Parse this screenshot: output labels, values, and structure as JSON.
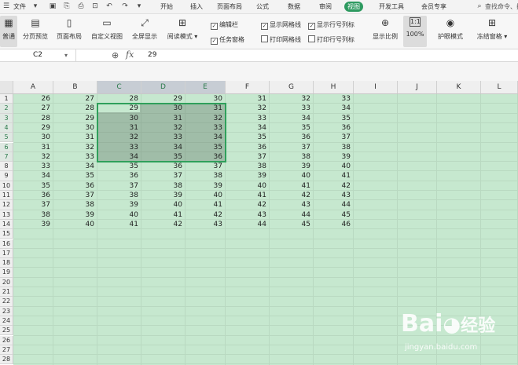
{
  "menubar": {
    "file_label": "文件",
    "tabs": [
      "开始",
      "插入",
      "页面布局",
      "公式",
      "数据",
      "审阅",
      "视图",
      "开发工具",
      "会员专享"
    ],
    "active_tab": "视图",
    "search_placeholder": "查找命令、搜"
  },
  "ribbon": {
    "buttons": [
      "普通",
      "分页预览",
      "页面布局",
      "自定义视图",
      "全屏显示",
      "阅读模式"
    ],
    "checks": [
      {
        "label": "编辑栏",
        "checked": true
      },
      {
        "label": "显示网格线",
        "checked": true
      },
      {
        "label": "显示行号列标",
        "checked": true
      },
      {
        "label": "任务窗格",
        "checked": true
      },
      {
        "label": "打印网格线",
        "checked": false
      },
      {
        "label": "打印行号列标",
        "checked": false
      }
    ],
    "zoom_label": "显示比例",
    "zoom_value": "100%",
    "eye_label": "护眼模式",
    "freeze_label": "冻结窗格"
  },
  "formula": {
    "cell_ref": "C2",
    "fx": "fx",
    "value": "29"
  },
  "columns": [
    "A",
    "B",
    "C",
    "D",
    "E",
    "F",
    "G",
    "H",
    "I",
    "J",
    "K",
    "L"
  ],
  "highlighted_columns": [
    "C",
    "D",
    "E"
  ],
  "highlighted_rows": [
    2,
    3,
    4,
    5,
    6,
    7
  ],
  "row_numbers": [
    "1",
    "2",
    "3",
    "4",
    "5",
    "6",
    "7",
    "8",
    "9",
    "10",
    "11",
    "12",
    "13",
    "14",
    "15",
    "16",
    "17",
    "18",
    "19",
    "20",
    "21",
    "22",
    "23",
    "24",
    "25",
    "26",
    "27",
    "28"
  ],
  "cells": [
    [
      "26",
      "27",
      "28",
      "29",
      "30",
      "31",
      "32",
      "33"
    ],
    [
      "27",
      "28",
      "29",
      "30",
      "31",
      "32",
      "33",
      "34"
    ],
    [
      "28",
      "29",
      "30",
      "31",
      "32",
      "33",
      "34",
      "35"
    ],
    [
      "29",
      "30",
      "31",
      "32",
      "33",
      "34",
      "35",
      "36"
    ],
    [
      "30",
      "31",
      "32",
      "33",
      "34",
      "35",
      "36",
      "37"
    ],
    [
      "31",
      "32",
      "33",
      "34",
      "35",
      "36",
      "37",
      "38"
    ],
    [
      "32",
      "33",
      "34",
      "35",
      "36",
      "37",
      "38",
      "39"
    ],
    [
      "33",
      "34",
      "35",
      "36",
      "37",
      "38",
      "39",
      "40"
    ],
    [
      "34",
      "35",
      "36",
      "37",
      "38",
      "39",
      "40",
      "41"
    ],
    [
      "35",
      "36",
      "37",
      "38",
      "39",
      "40",
      "41",
      "42"
    ],
    [
      "36",
      "37",
      "38",
      "39",
      "40",
      "41",
      "42",
      "43"
    ],
    [
      "37",
      "38",
      "39",
      "40",
      "41",
      "42",
      "43",
      "44"
    ],
    [
      "38",
      "39",
      "40",
      "41",
      "42",
      "43",
      "44",
      "45"
    ],
    [
      "39",
      "40",
      "41",
      "42",
      "43",
      "44",
      "45",
      "46"
    ]
  ],
  "watermark": {
    "brand": "Bai",
    "brand2": "经验",
    "url": "jingyan.baidu.com"
  },
  "colors": {
    "sheet_bg": "#c6e8cf",
    "accent": "#2e9a60"
  }
}
